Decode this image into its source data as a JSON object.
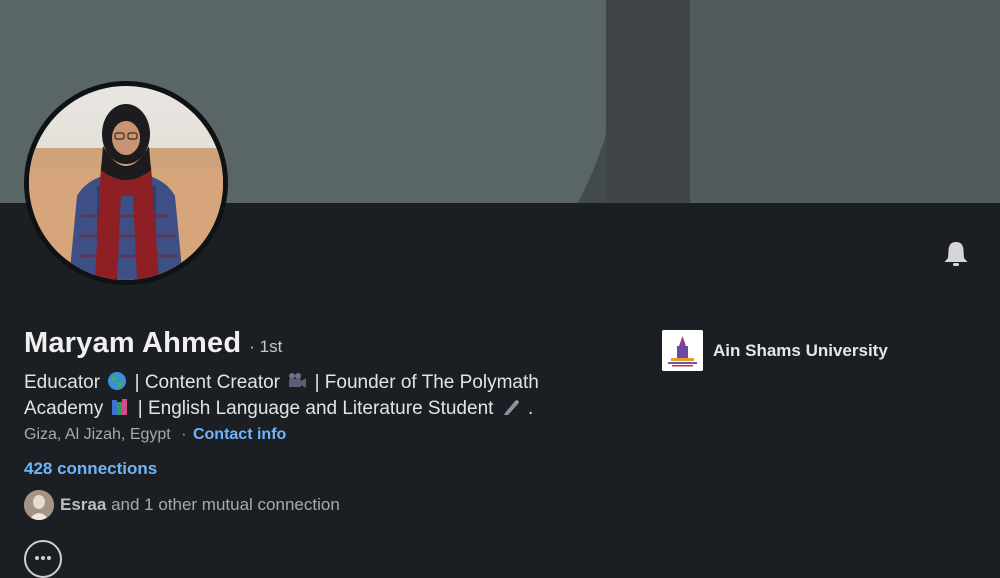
{
  "profile": {
    "name": "Maryam Ahmed",
    "degree": "· 1st",
    "headline": {
      "part1": "Educator",
      "part2": "| Content Creator",
      "part3": "| Founder of The Polymath",
      "part4": "Academy",
      "part5": "| English Language and Literature Student",
      "part6": "."
    },
    "location": "Giza, Al Jizah, Egypt",
    "location_sep": "·",
    "contact_info": "Contact info",
    "connections": "428 connections",
    "mutual": {
      "name": "Esraa",
      "text": "and 1 other mutual connection"
    }
  },
  "education": {
    "school": "Ain Shams University"
  },
  "icons": {
    "bell": "bell-icon",
    "globe": "globe-emoji",
    "camera": "movie-camera-emoji",
    "books": "books-emoji",
    "pen": "pen-emoji",
    "more": "more-icon"
  },
  "colors": {
    "background": "#1b1f23",
    "link": "#70b5f9",
    "cover_light": "#5a6566",
    "cover_dark": "#434a4c"
  }
}
